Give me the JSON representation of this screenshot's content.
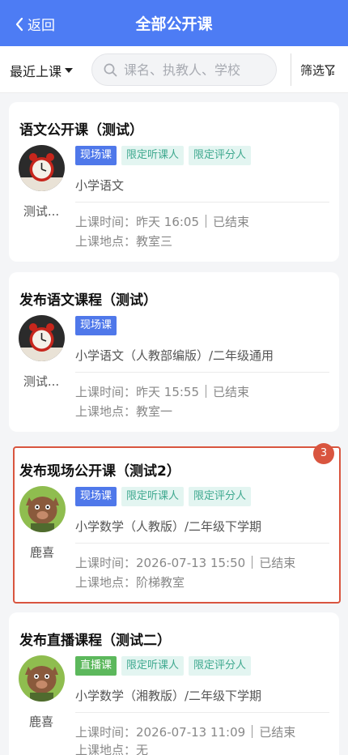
{
  "header": {
    "back_label": "返回",
    "title": "全部公开课"
  },
  "filter": {
    "sort_label": "最近上课",
    "search_placeholder": "课名、执教人、学校",
    "filter_label": "筛选"
  },
  "courses": [
    {
      "title": "语文公开课（测试）",
      "teacher": "测试...",
      "tags": [
        "现场课",
        "限定听课人",
        "限定评分人"
      ],
      "subject": "小学语文",
      "time_label": "上课时间：",
      "time": "昨天 16:05",
      "status": "已结束",
      "place_label": "上课地点：",
      "place": "教室三"
    },
    {
      "title": "发布语文课程（测试）",
      "teacher": "测试...",
      "tags": [
        "现场课"
      ],
      "subject": "小学语文（人教部编版）/二年级通用",
      "time_label": "上课时间：",
      "time": "昨天 15:55",
      "status": "已结束",
      "place_label": "上课地点：",
      "place": "教室一"
    },
    {
      "title": "发布现场公开课（测试2）",
      "teacher": "鹿喜",
      "tags": [
        "现场课",
        "限定听课人",
        "限定评分人"
      ],
      "subject": "小学数学（人教版）/二年级下学期",
      "time_label": "上课时间：",
      "time": "2026-07-13 15:50",
      "status": "已结束",
      "place_label": "上课地点：",
      "place": "阶梯教室",
      "badge": "3"
    },
    {
      "title": "发布直播课程（测试二）",
      "teacher": "鹿喜",
      "tags": [
        "直播课",
        "限定听课人",
        "限定评分人"
      ],
      "subject": "小学数学（湘教版）/二年级下学期",
      "time_label": "上课时间：",
      "time": "2026-07-13 11:09",
      "status": "已结束",
      "place_label": "上课地点：",
      "place": "无"
    }
  ],
  "colors": {
    "primary": "#4d7cf4",
    "highlight": "#d9553f",
    "live_stream": "#5cb85c",
    "teal_tag": "#3fa98f"
  },
  "icons": {
    "back": "chevron-left-icon",
    "search": "search-icon",
    "filter": "funnel-icon",
    "avatar_1": "alarm-clock-avatar",
    "avatar_2": "cartoon-boar-avatar"
  }
}
